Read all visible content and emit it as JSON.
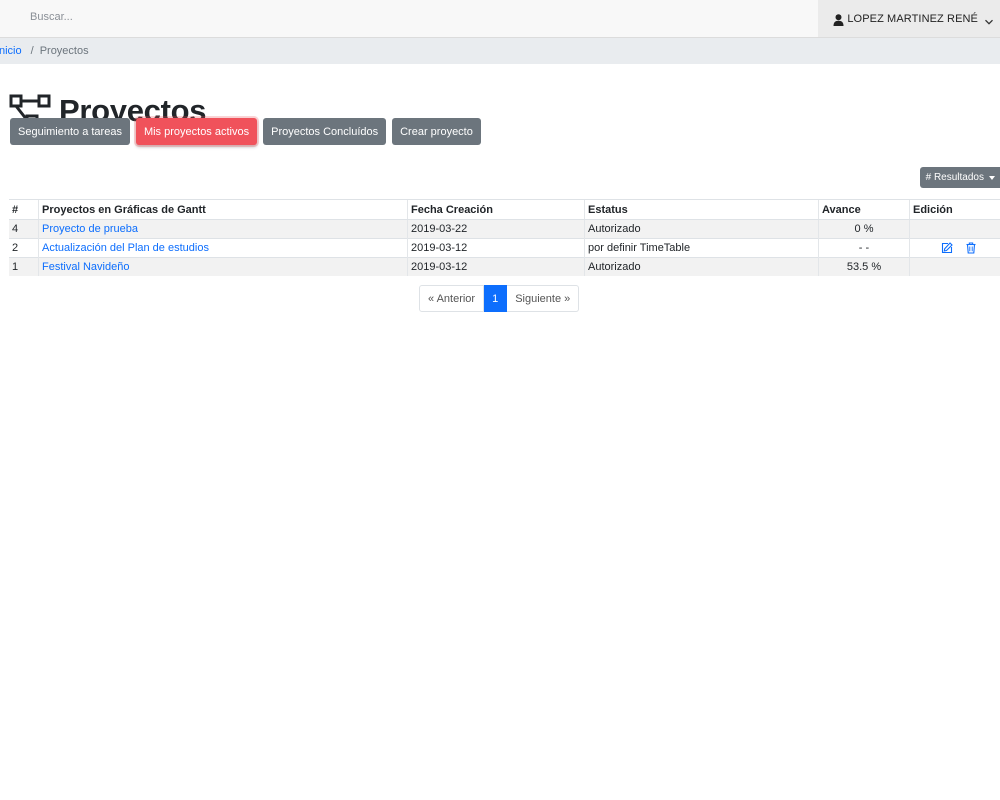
{
  "topbar": {
    "search_placeholder": "Buscar...",
    "user_name": "LOPEZ MARTINEZ RENÉ"
  },
  "breadcrumb": {
    "home": "nicio",
    "separator": "/",
    "current": "Proyectos"
  },
  "page": {
    "title": "Proyectos"
  },
  "actions": {
    "tracking": "Seguimiento a tareas",
    "active": "Mis proyectos activos",
    "concluded": "Proyectos Concluídos",
    "create": "Crear proyecto"
  },
  "results_dropdown": "# Resultados",
  "table": {
    "headers": {
      "num": "#",
      "project": "Proyectos en Gráficas de Gantt",
      "date": "Fecha Creación",
      "status": "Estatus",
      "advance": "Avance",
      "edit": "Edición"
    },
    "rows": [
      {
        "num": "4",
        "project": "Proyecto de prueba",
        "date": "2019-03-22",
        "status": "Autorizado",
        "advance": "0 %"
      },
      {
        "num": "2",
        "project": "Actualización del Plan de estudios",
        "date": "2019-03-12",
        "status": "por definir TimeTable",
        "advance": "- -"
      },
      {
        "num": "1",
        "project": "Festival Navideño",
        "date": "2019-03-12",
        "status": "Autorizado",
        "advance": "53.5 %"
      }
    ]
  },
  "pagination": {
    "prev": "« Anterior",
    "current": "1",
    "next": "Siguiente »"
  },
  "colors": {
    "primary": "#0d6efd",
    "secondary": "#6c757d",
    "danger": "#f0525b"
  }
}
